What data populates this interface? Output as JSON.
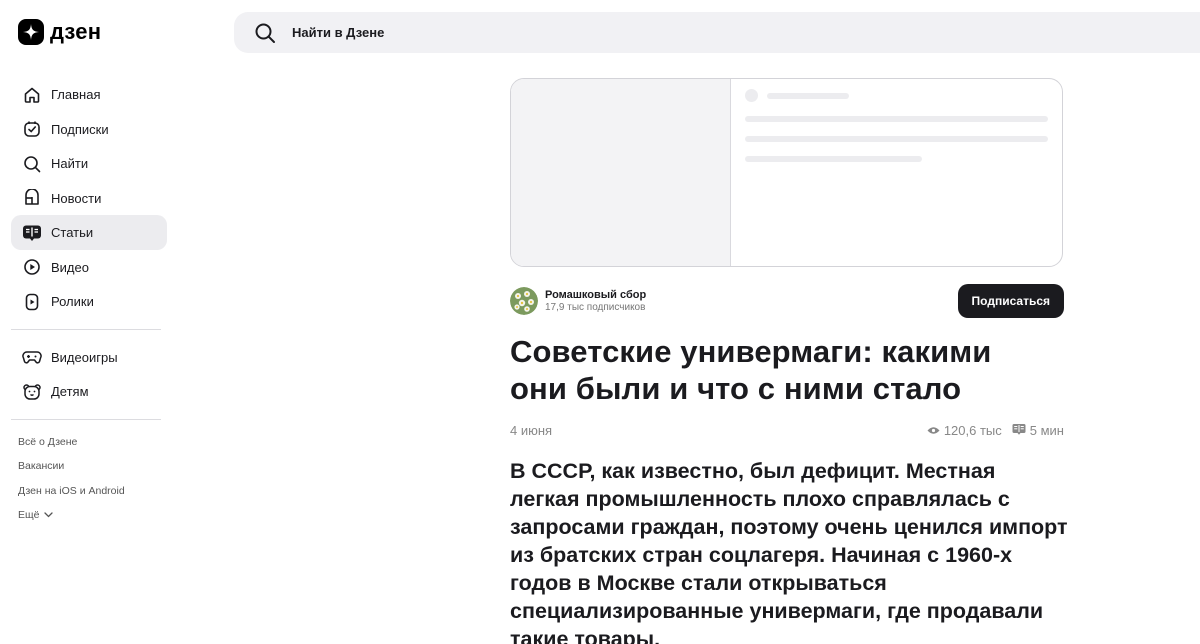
{
  "header": {
    "logo_text": "дзен",
    "search_placeholder": "Найти в Дзене"
  },
  "sidebar": {
    "items": [
      {
        "label": "Главная",
        "icon": "home-icon",
        "active": false
      },
      {
        "label": "Подписки",
        "icon": "subscriptions-icon",
        "active": false
      },
      {
        "label": "Найти",
        "icon": "search-icon",
        "active": false
      },
      {
        "label": "Новости",
        "icon": "news-icon",
        "active": false
      },
      {
        "label": "Статьи",
        "icon": "articles-icon",
        "active": true
      },
      {
        "label": "Видео",
        "icon": "video-icon",
        "active": false
      },
      {
        "label": "Ролики",
        "icon": "shorts-icon",
        "active": false
      }
    ],
    "items_secondary": [
      {
        "label": "Видеоигры",
        "icon": "gamepad-icon"
      },
      {
        "label": "Детям",
        "icon": "kids-icon"
      }
    ],
    "footer_links": [
      "Всё о Дзене",
      "Вакансии",
      "Дзен на iOS и Android"
    ],
    "more_label": "Ещё"
  },
  "article": {
    "channel_name": "Ромашковый сбор",
    "channel_subscribers": "17,9 тыс подписчиков",
    "subscribe_label": "Подписаться",
    "title": "Советские универмаги: какими они были и что с ними стало",
    "date": "4 июня",
    "views": "120,6 тыс",
    "read_time": "5 мин",
    "lead": "В СССР, как известно, был дефицит. Местная легкая промышленность плохо справлялась с запросами граждан, поэтому очень ценился импорт из братских стран соцлагеря. Начиная с 1960-х годов в Москве стали открываться специализированные универмаги, где продавали такие товары."
  },
  "colors": {
    "text_primary": "#1b1b1f",
    "active_bg": "#ececef",
    "search_bg": "#f1f1f4",
    "button_bg": "#1b1b1f"
  }
}
